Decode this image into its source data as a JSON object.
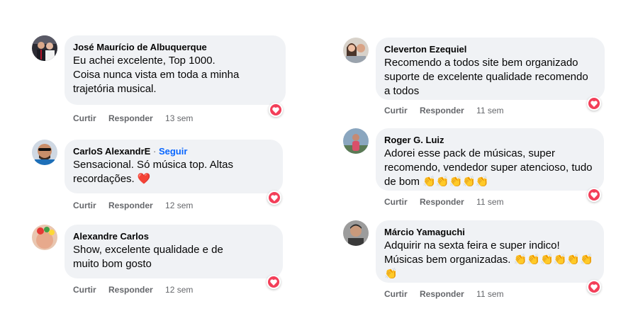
{
  "actions": {
    "like": "Curtir",
    "reply": "Responder"
  },
  "colors": {
    "bubble": "#f0f2f5",
    "follow": "#0866ff",
    "reaction_love": "#f33e58",
    "meta": "#65676b"
  },
  "comments": [
    {
      "author": "José Maurício de Albuquerque",
      "lines": [
        "Eu achei excelente, Top 1000.",
        "Coisa nunca vista em toda a minha",
        "trajetória musical."
      ],
      "time": "13 sem",
      "reaction": "love"
    },
    {
      "author": "CarloS AlexandrE",
      "follow_sep": "·",
      "follow": "Seguir",
      "lines": [
        "Sensacional. Só música top. Altas",
        "recordações. ❤️"
      ],
      "time": "12 sem",
      "reaction": "love"
    },
    {
      "author": "Alexandre Carlos",
      "lines": [
        "Show, excelente qualidade e de",
        "muito bom gosto"
      ],
      "time": "12 sem",
      "reaction": "love"
    },
    {
      "author": "Cleverton Ezequiel",
      "lines": [
        "Recomendo a todos site bem organizado",
        "suporte de excelente qualidade recomendo",
        "a todos"
      ],
      "time": "11 sem",
      "reaction": "love"
    },
    {
      "author": "Roger G. Luiz",
      "lines": [
        "Adorei esse pack de músicas, super",
        "recomendo, vendedor super atencioso, tudo",
        "de bom 👏👏👏👏👏"
      ],
      "time": "11 sem",
      "reaction": "love"
    },
    {
      "author": "Márcio Yamaguchi",
      "lines": [
        "Adquirir na sexta feira e super indico!",
        "Músicas bem organizadas. 👏👏👏👏👏👏",
        "👏"
      ],
      "time": "11 sem",
      "reaction": "love"
    }
  ]
}
